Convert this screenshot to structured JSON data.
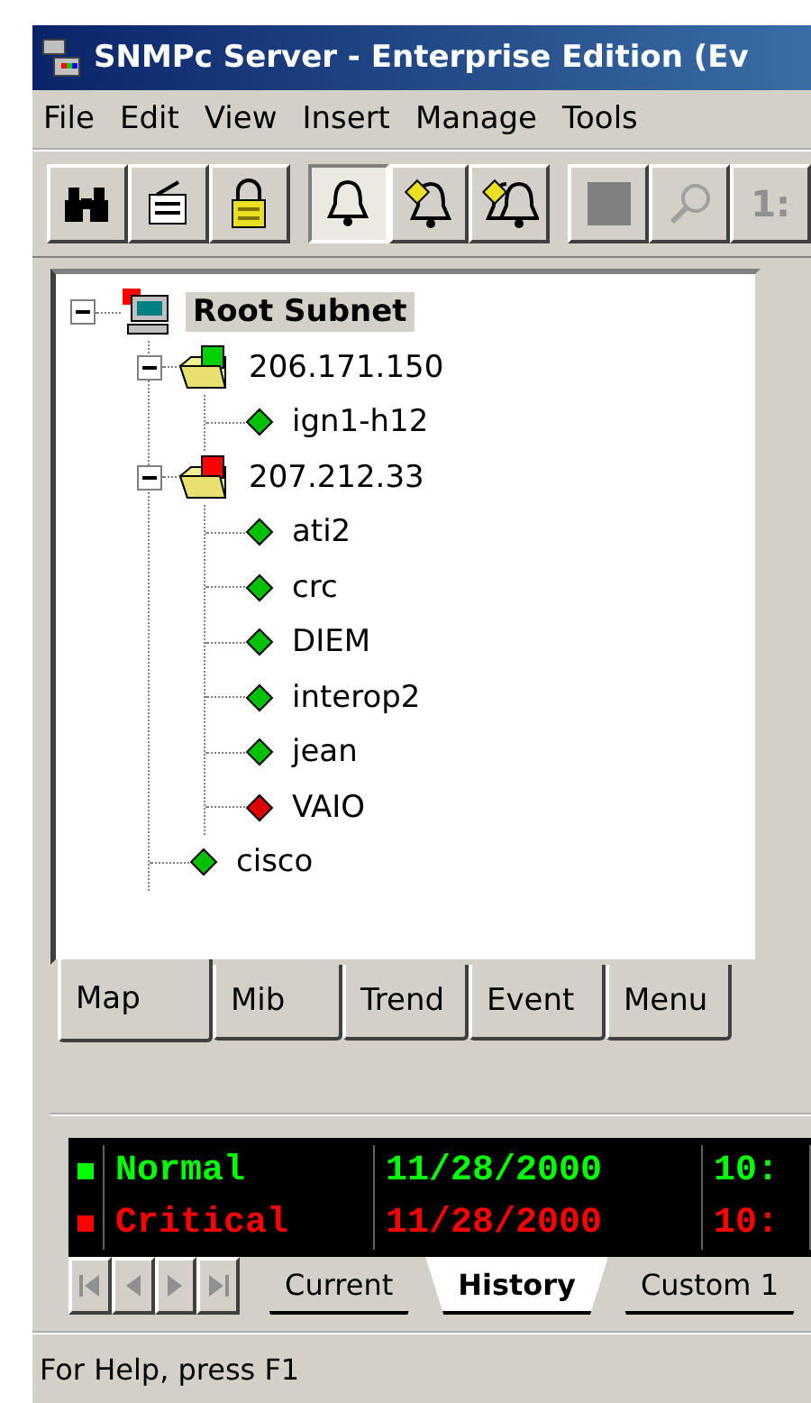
{
  "window": {
    "title": "SNMPc Server - Enterprise Edition (Ev"
  },
  "menu": [
    {
      "label": "File"
    },
    {
      "label": "Edit"
    },
    {
      "label": "View"
    },
    {
      "label": "Insert"
    },
    {
      "label": "Manage"
    },
    {
      "label": "Tools"
    }
  ],
  "toolbar": [
    {
      "kind": "binoculars",
      "pressed": false,
      "disabled": false
    },
    {
      "kind": "properties",
      "pressed": false,
      "disabled": false
    },
    {
      "kind": "lock",
      "pressed": false,
      "disabled": false
    },
    {
      "kind": "bell",
      "pressed": true,
      "disabled": false
    },
    {
      "kind": "bell-tag",
      "pressed": false,
      "disabled": false
    },
    {
      "kind": "bells",
      "pressed": false,
      "disabled": false
    },
    {
      "kind": "stop",
      "pressed": false,
      "disabled": true
    },
    {
      "kind": "zoom",
      "pressed": false,
      "disabled": true
    },
    {
      "kind": "text",
      "label": "1:",
      "pressed": false,
      "disabled": true
    }
  ],
  "tree": [
    {
      "kind": "root",
      "label": "Root Subnet",
      "selected": true,
      "expanded": true,
      "color": "#ff0000",
      "children": [
        {
          "kind": "subnet",
          "label": "206.171.150",
          "selected": false,
          "expanded": true,
          "color": "#00d000",
          "children": [
            {
              "kind": "device",
              "label": "ign1-h12",
              "selected": false,
              "color": "#00c000"
            }
          ]
        },
        {
          "kind": "subnet",
          "label": "207.212.33",
          "selected": false,
          "expanded": true,
          "color": "#ff0000",
          "children": [
            {
              "kind": "device",
              "label": "ati2",
              "selected": false,
              "color": "#00c000"
            },
            {
              "kind": "device",
              "label": "crc",
              "selected": false,
              "color": "#00c000"
            },
            {
              "kind": "device",
              "label": "DIEM",
              "selected": false,
              "color": "#00c000"
            },
            {
              "kind": "device",
              "label": "interop2",
              "selected": false,
              "color": "#00c000"
            },
            {
              "kind": "device",
              "label": "jean",
              "selected": false,
              "color": "#00c000"
            },
            {
              "kind": "device",
              "label": "VAIO",
              "selected": false,
              "color": "#e00000"
            }
          ]
        },
        {
          "kind": "device",
          "label": "cisco",
          "selected": false,
          "color": "#00c000"
        }
      ]
    }
  ],
  "view_tabs": [
    {
      "label": "Map",
      "selected": true
    },
    {
      "label": "Mib",
      "selected": false
    },
    {
      "label": "Trend",
      "selected": false
    },
    {
      "label": "Event",
      "selected": false
    },
    {
      "label": "Menu",
      "selected": false
    }
  ],
  "events": {
    "rows": [
      {
        "severity": "Normal",
        "date": "11/28/2000",
        "time": "10:",
        "color": "#00ff00"
      },
      {
        "severity": "Critical",
        "date": "11/28/2000",
        "time": "10:",
        "color": "#ff0000"
      }
    ],
    "tabs": [
      {
        "label": "Current",
        "selected": false
      },
      {
        "label": "History",
        "selected": true
      },
      {
        "label": "Custom 1",
        "selected": false
      }
    ]
  },
  "status_bar": {
    "text": "For Help, press F1"
  }
}
